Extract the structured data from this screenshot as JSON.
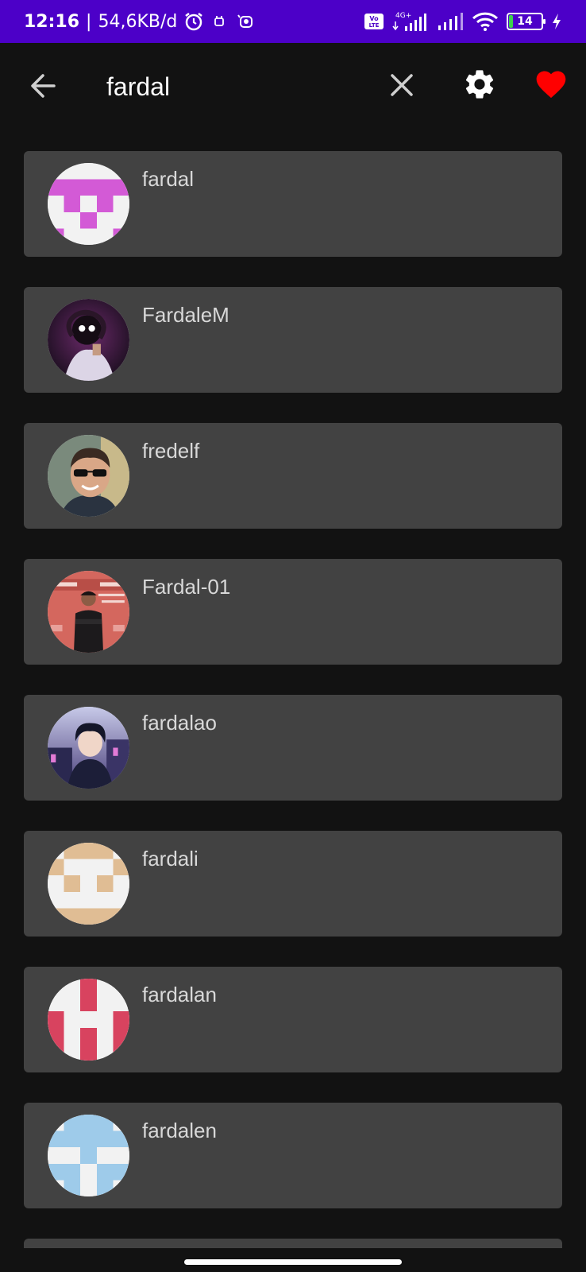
{
  "status_bar": {
    "time": "12:16",
    "speed": "54,6KB/d",
    "network": "4G+",
    "volte": "Vo LTE",
    "battery": "14"
  },
  "header": {
    "search_value": "fardal",
    "icons": [
      "back-arrow-icon",
      "close-icon",
      "gear-icon",
      "heart-icon"
    ],
    "heart_color": "#ff0000"
  },
  "results": [
    {
      "username": "fardal"
    },
    {
      "username": "FardaleM"
    },
    {
      "username": "fredelf"
    },
    {
      "username": "Fardal-01"
    },
    {
      "username": "fardalao"
    },
    {
      "username": "fardali"
    },
    {
      "username": "fardalan"
    },
    {
      "username": "fardalen"
    }
  ],
  "colors": {
    "status_bar": "#4c00c8",
    "background": "#121212",
    "card": "#424242",
    "identicon_1": "#d35ad6",
    "identicon_6": "#e0bd94",
    "identicon_7": "#d8435f",
    "identicon_8": "#9ecbea"
  }
}
